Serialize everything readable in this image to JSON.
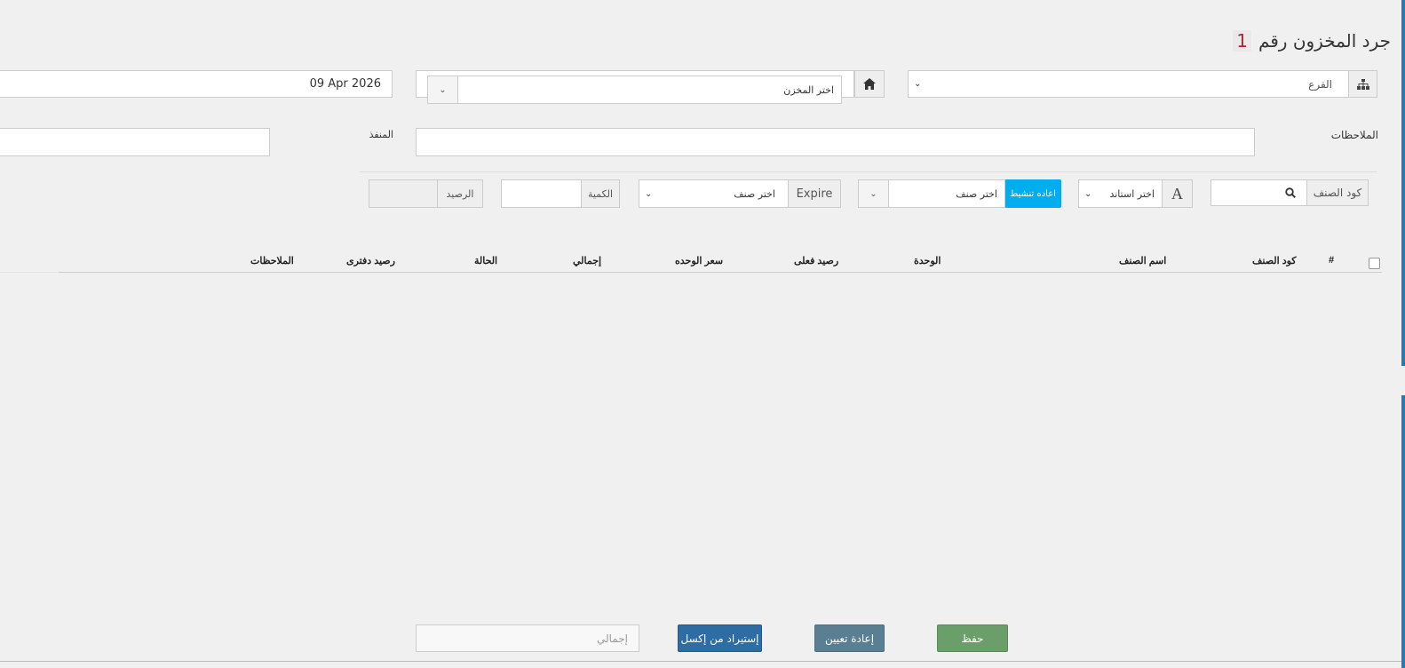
{
  "title": {
    "text": "جرد المخزون رقم",
    "number": "1"
  },
  "branch": {
    "placeholder": "الفرع",
    "icon": "sitemap-icon"
  },
  "warehouse": {
    "placeholder": "اختر المخزن",
    "icon": "home-icon"
  },
  "date": {
    "value": "09 Apr 2026"
  },
  "notes": {
    "label": "الملاحظات",
    "value": ""
  },
  "executor": {
    "label": "المنفذ",
    "value": ""
  },
  "item_code": {
    "label": "كود الصنف",
    "value": ""
  },
  "unit_select": {
    "placeholder": "اختر استاند"
  },
  "item_select": {
    "placeholder": "اختر صنف",
    "refresh_label": "اعاده تنشيط"
  },
  "expire": {
    "label": "Expire",
    "placeholder": "اختر صنف"
  },
  "quantity": {
    "label": "الكمية",
    "value": ""
  },
  "balance": {
    "label": "الرصيد",
    "value": ""
  },
  "table": {
    "columns": [
      "#",
      "كود الصنف",
      "اسم الصنف",
      "الوحدة",
      "رصيد فعلى",
      "سعر الوحده",
      "إجمالي",
      "الحالة",
      "رصيد دفترى",
      "الملاحظات"
    ]
  },
  "footer": {
    "save_label": "حفظ",
    "reset_label": "إعادة تعيين",
    "import_label": "إستيراد من إكسل",
    "total_placeholder": "إجمالي"
  },
  "colors": {
    "save": "#6a9f6a",
    "reset": "#5a7f92",
    "import": "#2e6da4",
    "refresh": "#00aeef"
  }
}
